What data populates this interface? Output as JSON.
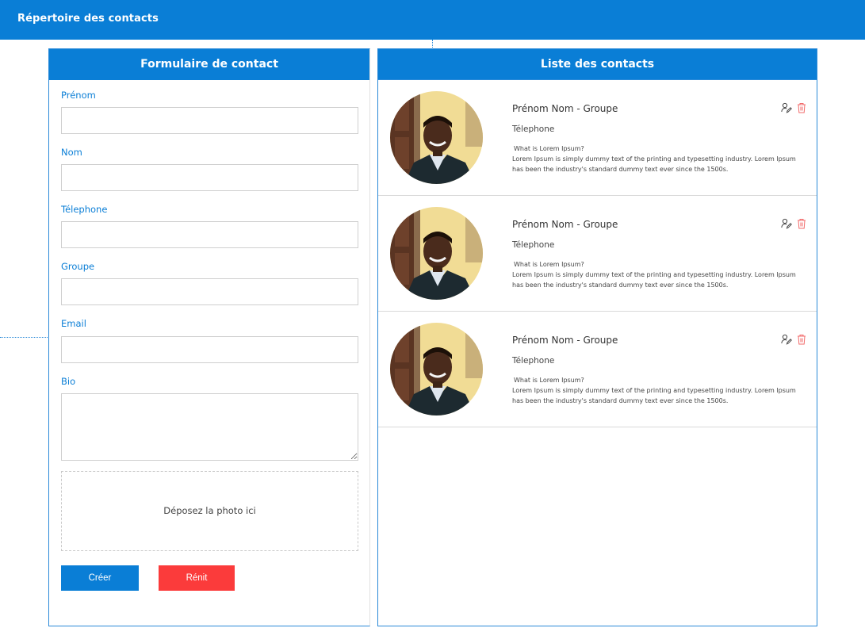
{
  "app": {
    "title": "Répertoire des contacts"
  },
  "form": {
    "header": "Formulaire de contact",
    "fields": [
      {
        "label": "Prénom",
        "value": "",
        "placeholder": ""
      },
      {
        "label": "Nom",
        "value": "",
        "placeholder": ""
      },
      {
        "label": "Télephone",
        "value": "",
        "placeholder": ""
      },
      {
        "label": "Groupe",
        "value": "",
        "placeholder": ""
      },
      {
        "label": "Email",
        "value": "",
        "placeholder": ""
      }
    ],
    "bio": {
      "label": "Bio",
      "value": "",
      "placeholder": ""
    },
    "dropzone_text": "Déposez la photo ici",
    "create_label": "Créer",
    "reset_label": "Rénit"
  },
  "list": {
    "header": "Liste des contacts",
    "contacts": [
      {
        "title": "Prénom Nom - Groupe",
        "phone": "Télephone",
        "bio_question": "What is Lorem Ipsum?",
        "bio_text": "Lorem Ipsum is simply dummy text of the printing and typesetting industry. Lorem Ipsum has been the industry's standard dummy text ever since the 1500s."
      },
      {
        "title": "Prénom Nom - Groupe",
        "phone": "Télephone",
        "bio_question": "What is Lorem Ipsum?",
        "bio_text": "Lorem Ipsum is simply dummy text of the printing and typesetting industry. Lorem Ipsum has been the industry's standard dummy text ever since the 1500s."
      },
      {
        "title": "Prénom Nom - Groupe",
        "phone": "Télephone",
        "bio_question": "What is Lorem Ipsum?",
        "bio_text": "Lorem Ipsum is simply dummy text of the printing and typesetting industry. Lorem Ipsum has been the industry's standard dummy text ever since the 1500s."
      }
    ]
  },
  "colors": {
    "primary": "#0a7ed6",
    "danger": "#fb3b3b",
    "border": "#cfcfcf"
  },
  "icons": {
    "edit": "edit-user-icon",
    "delete": "trash-icon"
  }
}
